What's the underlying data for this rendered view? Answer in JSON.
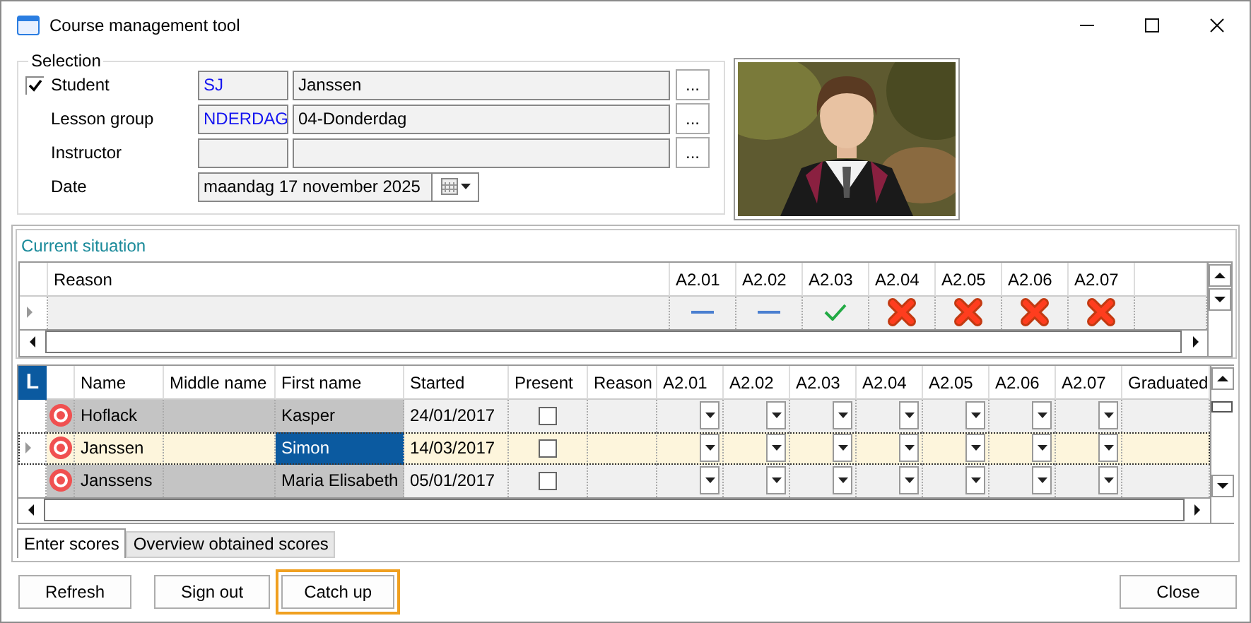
{
  "window": {
    "title": "Course management tool"
  },
  "selection": {
    "title": "Selection",
    "fields": [
      {
        "kind": "lookup",
        "label": "Student",
        "checked": true,
        "code": "SJ",
        "value": "Janssen",
        "button": "..."
      },
      {
        "kind": "lookup",
        "label": "Lesson group",
        "code": "NDERDAG",
        "value": "04-Donderdag",
        "button": "..."
      },
      {
        "kind": "lookup",
        "label": "Instructor",
        "button": "..."
      },
      {
        "kind": "date",
        "label": "Date",
        "value": "maandag 17 november 2025"
      }
    ]
  },
  "current_situation": {
    "title": "Current situation",
    "columns": [
      "Reason",
      "A2.01",
      "A2.02",
      "A2.03",
      "A2.04",
      "A2.05",
      "A2.06",
      "A2.07"
    ],
    "rows": [
      {
        "marks": [
          {
            "kind": "dash"
          },
          {
            "kind": "dash"
          },
          {
            "kind": "check"
          },
          {
            "kind": "cross"
          },
          {
            "kind": "cross"
          },
          {
            "kind": "cross"
          },
          {
            "kind": "cross"
          }
        ]
      }
    ]
  },
  "students": {
    "badge": "L",
    "columns": [
      "Name",
      "Middle name",
      "First name",
      "Started",
      "Present",
      "Reason",
      "A2.01",
      "A2.02",
      "A2.03",
      "A2.04",
      "A2.05",
      "A2.06",
      "A2.07",
      "Graduated"
    ],
    "rows": [
      {
        "name": "Hoflack",
        "first_name": "Kasper",
        "started": "24/01/2017",
        "present": false,
        "selected": false
      },
      {
        "name": "Janssen",
        "first_name": "Simon",
        "started": "14/03/2017",
        "present": false,
        "selected": true
      },
      {
        "name": "Janssens",
        "first_name": "Maria Elisabeth",
        "started": "05/01/2017",
        "present": false,
        "selected": false
      }
    ]
  },
  "tabs": [
    {
      "label": "Enter scores",
      "selected": true
    },
    {
      "label": "Overview obtained scores",
      "selected": false
    }
  ],
  "buttons": [
    {
      "label": "Refresh",
      "focused": false
    },
    {
      "label": "Sign out",
      "focused": false
    },
    {
      "label": "Catch up",
      "focused": true
    }
  ],
  "close_button": {
    "label": "Close"
  }
}
